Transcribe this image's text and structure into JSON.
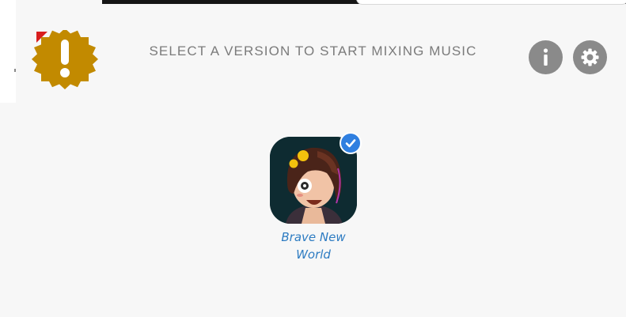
{
  "header": {
    "title": "SELECT A VERSION TO START MIXING MUSIC",
    "info_icon": "info-icon",
    "settings_icon": "gear-icon",
    "alert_icon": "alert-badge-icon"
  },
  "versions": [
    {
      "label_line1": "Brave New",
      "label_line2": "World",
      "selected": true,
      "artwork": "character-artwork"
    }
  ],
  "colors": {
    "background": "#f7f7f7",
    "title_text": "#7b7b7b",
    "button_gray": "#8a8a8a",
    "badge_gold": "#c28a00",
    "badge_red": "#d81e1e",
    "check_blue": "#2f7fe0",
    "label_blue": "#2e7cc2"
  }
}
